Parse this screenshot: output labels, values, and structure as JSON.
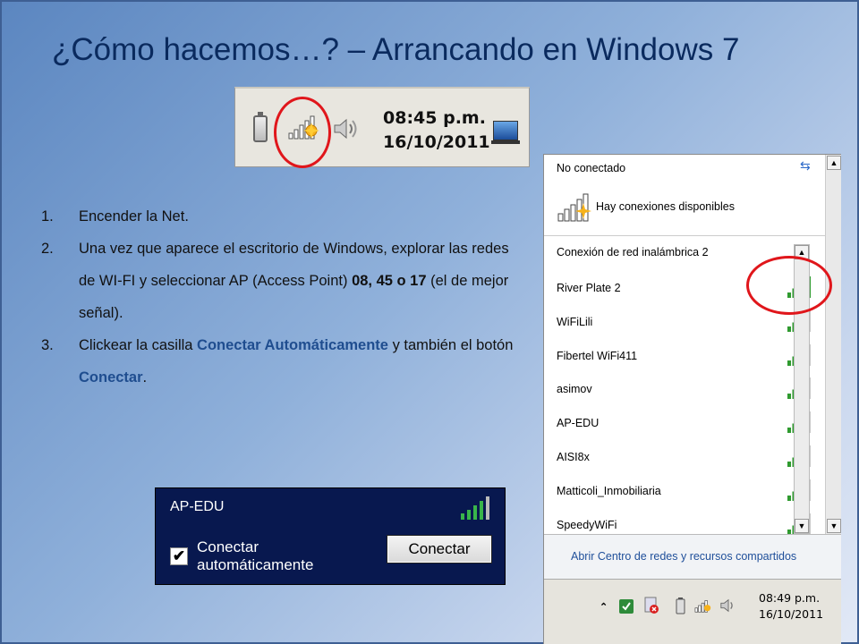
{
  "slide": {
    "title": "¿Cómo hacemos…? – Arrancando en Windows 7"
  },
  "taskbar_top": {
    "time": "08:45 p.m.",
    "date": "16/10/2011"
  },
  "steps": [
    {
      "num": "1.",
      "text": "Encender la Net."
    },
    {
      "num": "2.",
      "text_a": "Una vez que aparece el escritorio de Windows, explorar las redes de WI-FI y seleccionar AP (Access Point) ",
      "bold": "08, 45 o 17",
      "text_b": " (el de mejor señal)."
    },
    {
      "num": "3.",
      "text_a": "Clickear  la casilla ",
      "hl1": "Conectar Automáticamente",
      "text_b": " y también el botón ",
      "hl2": "Conectar",
      "text_c": "."
    }
  ],
  "connect_box": {
    "network": "AP-EDU",
    "checkbox_label": "Conectar automáticamente",
    "checked": true,
    "button_label": "Conectar"
  },
  "wifi_panel": {
    "status": "No conectado",
    "available": "Hay conexiones disponibles",
    "connection_name": "Conexión de red inalámbrica 2",
    "networks": [
      {
        "name": "River Plate 2",
        "signal": 5
      },
      {
        "name": "WiFiLili",
        "signal": 4
      },
      {
        "name": "Fibertel WiFi411",
        "signal": 4
      },
      {
        "name": "asimov",
        "signal": 4
      },
      {
        "name": "AP-EDU",
        "signal": 4
      },
      {
        "name": "AISI8x",
        "signal": 4
      },
      {
        "name": "Matticoli_Inmobiliaria",
        "signal": 4
      },
      {
        "name": "SpeedyWiFi",
        "signal": 4
      }
    ],
    "footer_link": "Abrir Centro de redes y recursos compartidos",
    "time": "08:49 p.m.",
    "date": "16/10/2011"
  },
  "colors": {
    "accent_text": "#1f4d8f",
    "highlight_circle": "#e0161b",
    "signal_green": "#2f9a2f"
  }
}
